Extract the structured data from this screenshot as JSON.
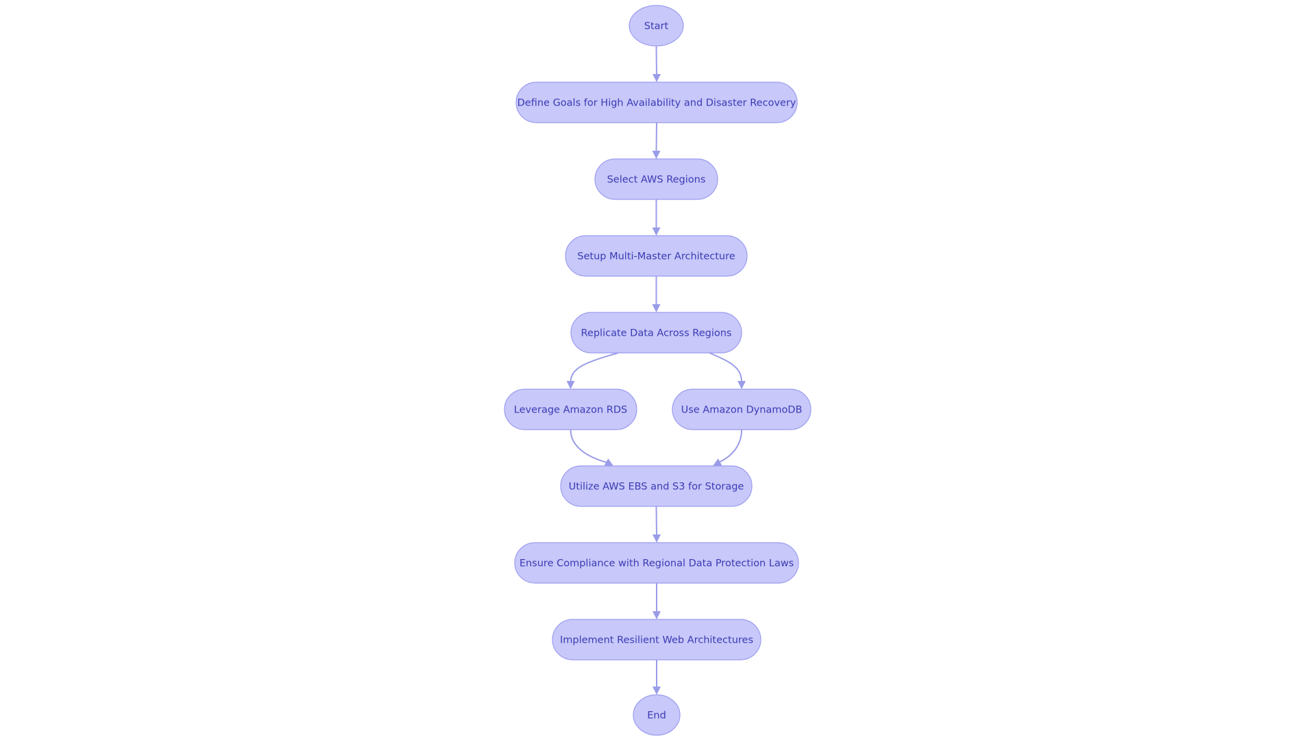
{
  "diagram": {
    "type": "flowchart",
    "direction": "top-down",
    "colors": {
      "node_fill": "#c8c8fa",
      "node_stroke": "#9c9cf0",
      "node_text": "#3a3ab4",
      "edge": "#9a9ce8"
    },
    "nodes": [
      {
        "id": "start",
        "label": "Start",
        "shape": "circle"
      },
      {
        "id": "goals",
        "label": "Define Goals for High Availability and Disaster Recovery",
        "shape": "stadium"
      },
      {
        "id": "regions",
        "label": "Select AWS Regions",
        "shape": "stadium"
      },
      {
        "id": "multimaster",
        "label": "Setup Multi-Master Architecture",
        "shape": "stadium"
      },
      {
        "id": "replicate",
        "label": "Replicate Data Across Regions",
        "shape": "stadium"
      },
      {
        "id": "rds",
        "label": "Leverage Amazon RDS",
        "shape": "stadium"
      },
      {
        "id": "dynamo",
        "label": "Use Amazon DynamoDB",
        "shape": "stadium"
      },
      {
        "id": "storage",
        "label": "Utilize AWS EBS and S3 for Storage",
        "shape": "stadium"
      },
      {
        "id": "compliance",
        "label": "Ensure Compliance with Regional Data Protection Laws",
        "shape": "stadium"
      },
      {
        "id": "resilient",
        "label": "Implement Resilient Web Architectures",
        "shape": "stadium"
      },
      {
        "id": "end",
        "label": "End",
        "shape": "circle"
      }
    ],
    "edges": [
      {
        "from": "start",
        "to": "goals"
      },
      {
        "from": "goals",
        "to": "regions"
      },
      {
        "from": "regions",
        "to": "multimaster"
      },
      {
        "from": "multimaster",
        "to": "replicate"
      },
      {
        "from": "replicate",
        "to": "rds"
      },
      {
        "from": "replicate",
        "to": "dynamo"
      },
      {
        "from": "rds",
        "to": "storage"
      },
      {
        "from": "dynamo",
        "to": "storage"
      },
      {
        "from": "storage",
        "to": "compliance"
      },
      {
        "from": "compliance",
        "to": "resilient"
      },
      {
        "from": "resilient",
        "to": "end"
      }
    ]
  }
}
